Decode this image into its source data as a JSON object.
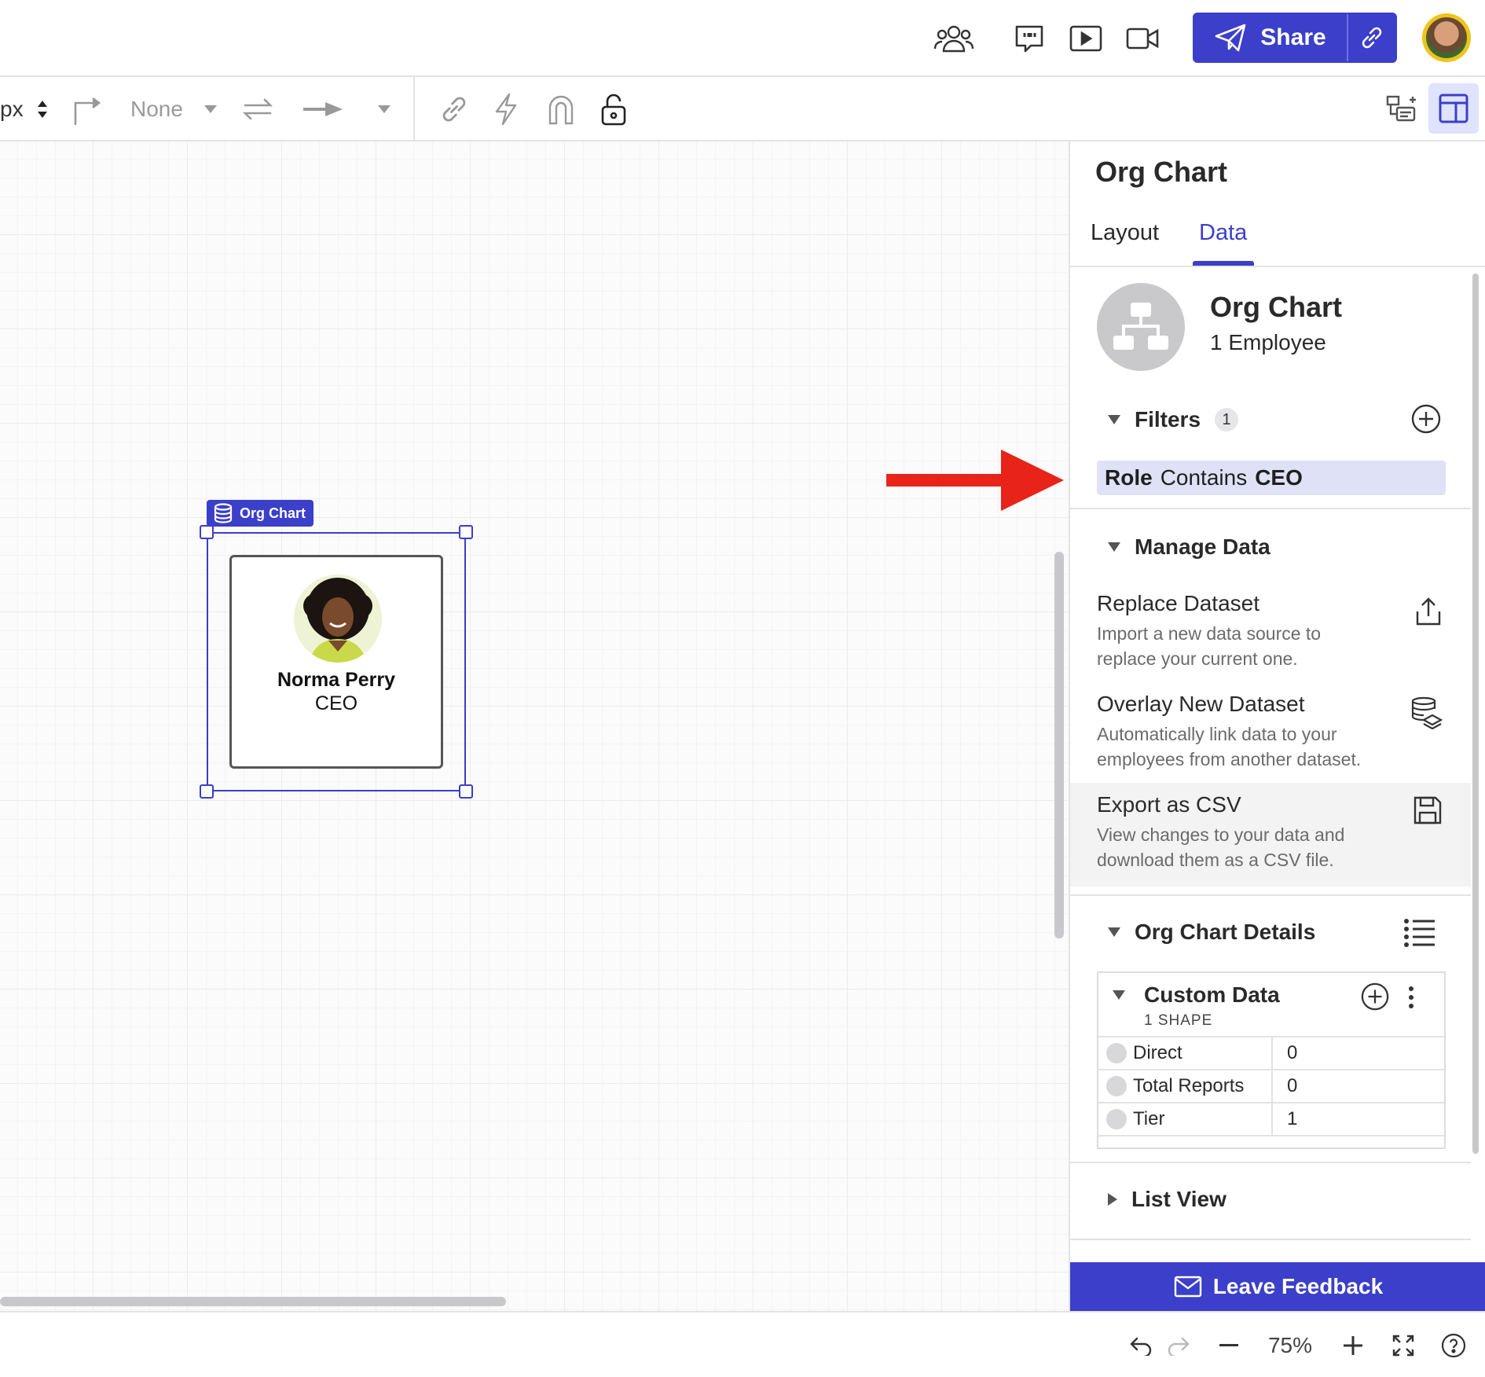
{
  "topbar": {
    "icons": [
      "people-icon",
      "comment-icon",
      "present-icon",
      "video-icon"
    ],
    "share_label": "Share"
  },
  "toolbar": {
    "unit_label": "px",
    "arrow_start": "None",
    "lock_state": "unlocked"
  },
  "canvas": {
    "tag_label": "Org Chart",
    "employee": {
      "name": "Norma Perry",
      "role": "CEO"
    }
  },
  "panel": {
    "title": "Org Chart",
    "tabs": [
      {
        "label": "Layout",
        "active": false
      },
      {
        "label": "Data",
        "active": true
      }
    ],
    "summary": {
      "title": "Org Chart",
      "count": "1 Employee"
    },
    "filters": {
      "title": "Filters",
      "count": "1",
      "chip": {
        "field": "Role",
        "op": "Contains",
        "value": "CEO"
      }
    },
    "manage": {
      "title": "Manage Data",
      "items": [
        {
          "title": "Replace Dataset",
          "desc": "Import a new data source to replace your current one."
        },
        {
          "title": "Overlay New Dataset",
          "desc": "Automatically link data to your employees from another dataset."
        },
        {
          "title": "Export as CSV",
          "desc": "View changes to your data and download them as a CSV file."
        }
      ]
    },
    "details": {
      "title": "Org Chart Details",
      "custom_title": "Custom Data",
      "custom_sub": "1 SHAPE",
      "rows": [
        {
          "key": "Direct",
          "value": "0"
        },
        {
          "key": "Total Reports",
          "value": "0"
        },
        {
          "key": "Tier",
          "value": "1"
        }
      ]
    },
    "list_view": "List View",
    "feedback": "Leave Feedback"
  },
  "bottombar": {
    "zoom": "75%"
  },
  "colors": {
    "accent": "#3b3fc9",
    "annotation_arrow": "#e8231a",
    "chip_bg": "#dfe2f7"
  }
}
